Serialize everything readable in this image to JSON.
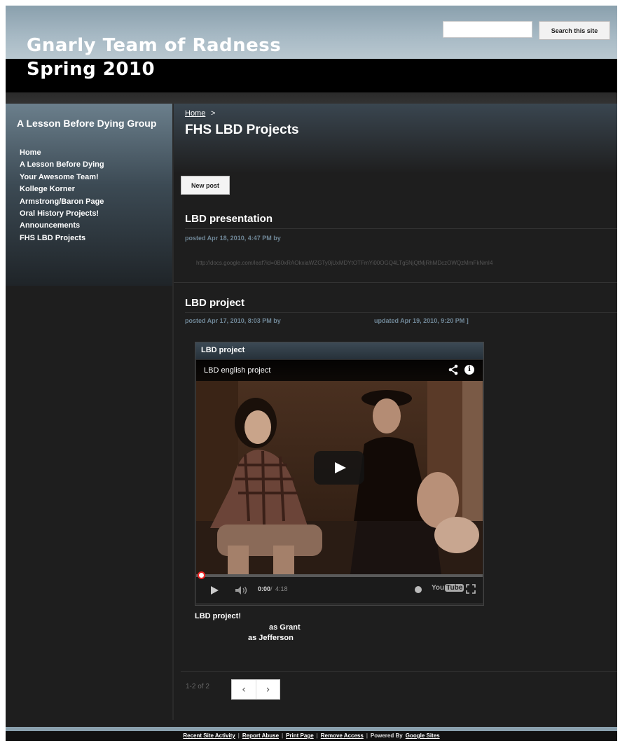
{
  "header": {
    "title_line1": "Gnarly Team of Radness",
    "title_line2": "Spring 2010",
    "search_button": "Search this site",
    "search_placeholder": ""
  },
  "sidebar": {
    "heading": "A Lesson Before Dying Group",
    "items": [
      {
        "label": "Home"
      },
      {
        "label": "A Lesson Before Dying"
      },
      {
        "label": "Your Awesome Team!"
      },
      {
        "label": "Kollege Korner"
      },
      {
        "label": "Armstrong/Baron Page"
      },
      {
        "label": "Oral History Projects!"
      },
      {
        "label": "Announcements"
      },
      {
        "label": "FHS LBD Projects"
      }
    ]
  },
  "breadcrumb": {
    "home": "Home",
    "separator": ">"
  },
  "page_title": "FHS LBD Projects",
  "new_post_label": "New post",
  "posts": [
    {
      "title": "LBD presentation",
      "meta": "posted Apr 18, 2010, 4:47 PM by",
      "link": "http://docs.google.com/leaf?id=0B0xRAOkxiaWZGTy0jUxMDYtOTFmYi00OGQ4LTg5NjQtMjRhMDczOWQzMmFkNmI4"
    },
    {
      "title": "LBD project",
      "meta": "posted Apr 17, 2010, 8:03 PM by",
      "updated": "updated Apr 19, 2010, 9:20 PM ]"
    }
  ],
  "video": {
    "gadget_title": "LBD project",
    "title": "LBD english project",
    "time_current": "0:00",
    "time_sep": "/",
    "time_total": "4:18",
    "progress": 0,
    "youtube_you": "You",
    "youtube_tube": "Tube"
  },
  "caption": {
    "title": "LBD project!",
    "cast_grant": "as Grant",
    "cast_jefferson": "as Jefferson"
  },
  "pager": {
    "count": "1-2 of 2",
    "prev": "‹",
    "next": "›"
  },
  "footer": {
    "links": [
      "Recent Site Activity",
      "Report Abuse",
      "Print Page",
      "Remove Access"
    ],
    "powered_by": "Powered By",
    "google_sites": "Google Sites"
  },
  "colors": {
    "header_band": "#a8bac5",
    "background": "#1e1e1e",
    "meta_text": "#6f8696"
  },
  "icons": [
    "share-icon",
    "info-icon",
    "play-icon",
    "volume-icon",
    "settings-icon",
    "fullscreen-icon"
  ]
}
